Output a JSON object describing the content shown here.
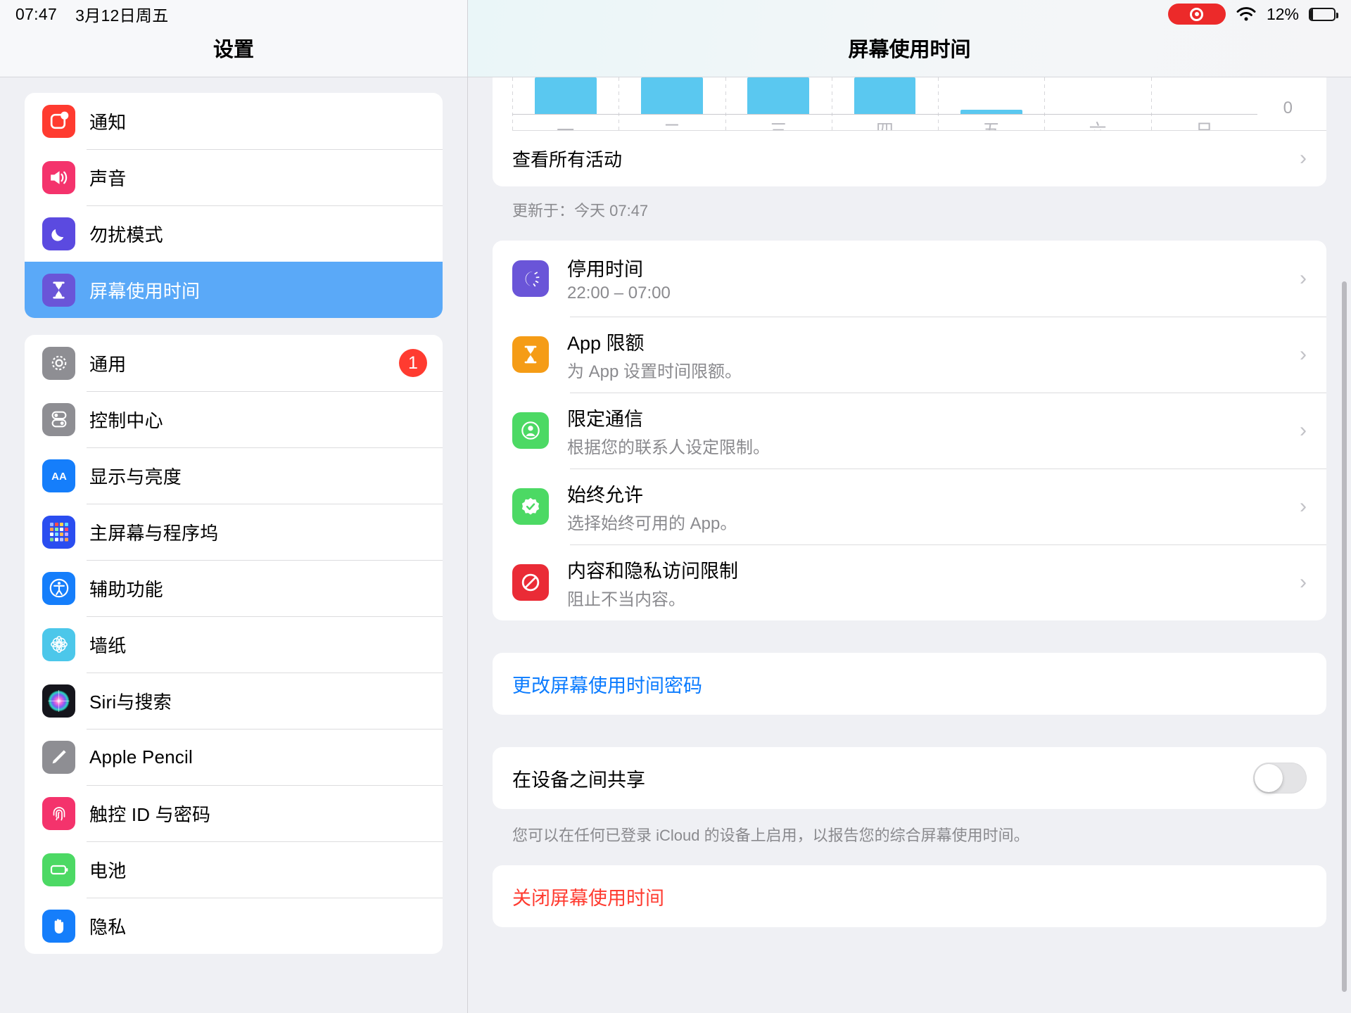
{
  "statusbar": {
    "time": "07:47",
    "date": "3月12日周五",
    "battery_percent": "12%",
    "recording_icon": "screen-recording-icon",
    "wifi_icon": "wifi-icon",
    "battery_icon": "battery-icon"
  },
  "sidebar": {
    "title": "设置",
    "groups": [
      {
        "items": [
          {
            "label": "通知",
            "icon": "notifications-icon",
            "color": "#ff3b30",
            "selected": false
          },
          {
            "label": "声音",
            "icon": "sound-icon",
            "color": "#f4336c",
            "selected": false
          },
          {
            "label": "勿扰模式",
            "icon": "moon-icon",
            "color": "#5b4ae0",
            "selected": false
          },
          {
            "label": "屏幕使用时间",
            "icon": "hourglass-icon",
            "color": "#6a55d8",
            "selected": true
          }
        ]
      },
      {
        "items": [
          {
            "label": "通用",
            "icon": "gear-icon",
            "color": "#8e8e93",
            "badge": "1",
            "selected": false
          },
          {
            "label": "控制中心",
            "icon": "control-center-icon",
            "color": "#8e8e93",
            "selected": false
          },
          {
            "label": "显示与亮度",
            "icon": "display-brightness-icon",
            "color": "#157efb",
            "selected": false
          },
          {
            "label": "主屏幕与程序坞",
            "icon": "home-screen-dock-icon",
            "color": "#2a4df0",
            "selected": false
          },
          {
            "label": "辅助功能",
            "icon": "accessibility-icon",
            "color": "#157efb",
            "selected": false
          },
          {
            "label": "墙纸",
            "icon": "wallpaper-icon",
            "color": "#4cc7ea",
            "selected": false
          },
          {
            "label": "Siri与搜索",
            "icon": "siri-icon",
            "color": "#1c1c25",
            "selected": false
          },
          {
            "label": "Apple Pencil",
            "icon": "pencil-icon",
            "color": "#8e8e93",
            "selected": false
          },
          {
            "label": "触控 ID 与密码",
            "icon": "touch-id-icon",
            "color": "#f4336c",
            "selected": false
          },
          {
            "label": "电池",
            "icon": "battery-green-icon",
            "color": "#4cd964",
            "selected": false
          },
          {
            "label": "隐私",
            "icon": "privacy-hand-icon",
            "color": "#157efb",
            "selected": false
          }
        ]
      }
    ]
  },
  "detail": {
    "title": "屏幕使用时间",
    "view_all_activity": "查看所有活动",
    "updated_at": "更新于：今天 07:47",
    "settings": [
      {
        "title": "停用时间",
        "subtitle": "22:00 – 07:00",
        "icon": "downtime-icon",
        "color": "#6a55d8"
      },
      {
        "title": "App 限额",
        "subtitle": "为 App 设置时间限额。",
        "icon": "app-limits-hourglass-icon",
        "color": "#f59c16"
      },
      {
        "title": "限定通信",
        "subtitle": "根据您的联系人设定限制。",
        "icon": "communication-limits-icon",
        "color": "#4cd964"
      },
      {
        "title": "始终允许",
        "subtitle": "选择始终可用的 App。",
        "icon": "always-allowed-check-icon",
        "color": "#4cd964"
      },
      {
        "title": "内容和隐私访问限制",
        "subtitle": "阻止不当内容。",
        "icon": "content-restrictions-icon",
        "color": "#ea2b36"
      }
    ],
    "change_passcode": "更改屏幕使用时间密码",
    "share_across_devices": "在设备之间共享",
    "share_toggle_on": false,
    "share_footnote": "您可以在任何已登录 iCloud 的设备上启用，以报告您的综合屏幕使用时间。",
    "turn_off": "关闭屏幕使用时间"
  },
  "chart_data": {
    "type": "bar",
    "title": "",
    "categories": [
      "一",
      "二",
      "三",
      "四",
      "五",
      "六",
      "日"
    ],
    "values": [
      52,
      52,
      52,
      52,
      6,
      0,
      0
    ],
    "tick_labels": [
      "0"
    ],
    "ylim": [
      0,
      52
    ],
    "xlabel": "",
    "ylabel": "",
    "grid": true,
    "bar_color": "#5ac8f0",
    "note": "weekly screen time bar chart, top portion scrolled out of view"
  }
}
